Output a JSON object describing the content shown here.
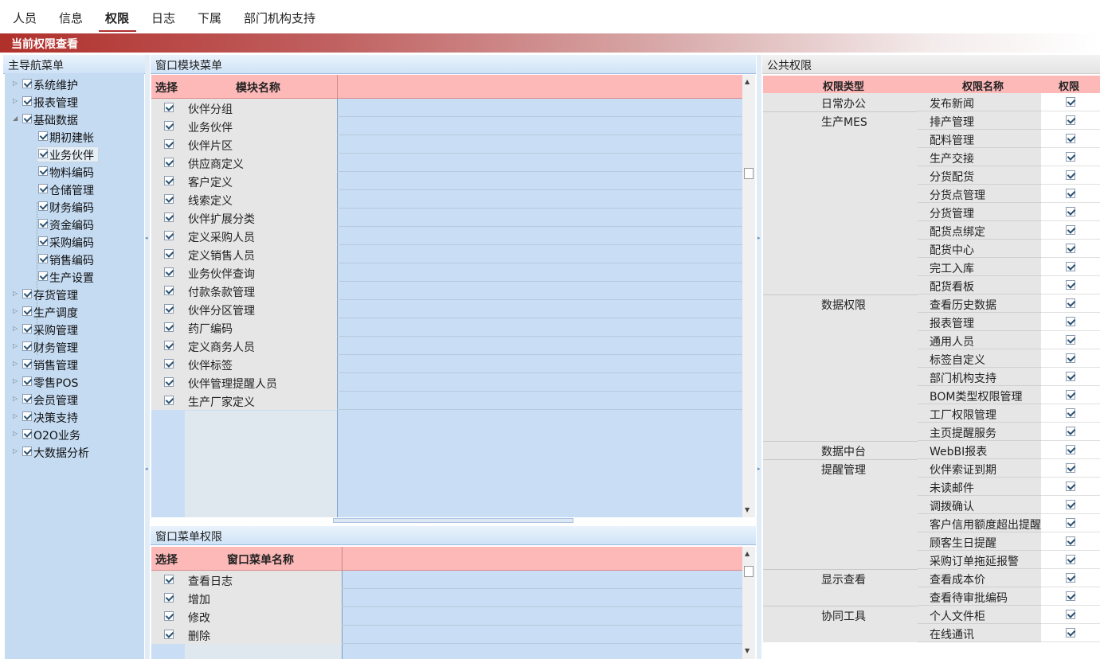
{
  "tabs": [
    {
      "label": "人员"
    },
    {
      "label": "信息"
    },
    {
      "label": "权限"
    },
    {
      "label": "日志"
    },
    {
      "label": "下属"
    },
    {
      "label": "部门机构支持"
    }
  ],
  "title": "当前权限查看",
  "nav": {
    "header": "主导航菜单",
    "items": [
      {
        "label": "系统维护",
        "level": 0,
        "expanded": false
      },
      {
        "label": "报表管理",
        "level": 0,
        "expanded": false
      },
      {
        "label": "基础数据",
        "level": 0,
        "expanded": true
      },
      {
        "label": "期初建帐",
        "level": 1
      },
      {
        "label": "业务伙伴",
        "level": 1,
        "selected": true
      },
      {
        "label": "物料编码",
        "level": 1
      },
      {
        "label": "仓储管理",
        "level": 1
      },
      {
        "label": "财务编码",
        "level": 1
      },
      {
        "label": "资金编码",
        "level": 1
      },
      {
        "label": "采购编码",
        "level": 1
      },
      {
        "label": "销售编码",
        "level": 1
      },
      {
        "label": "生产设置",
        "level": 1
      },
      {
        "label": "存货管理",
        "level": 0,
        "expanded": false
      },
      {
        "label": "生产调度",
        "level": 0,
        "expanded": false
      },
      {
        "label": "采购管理",
        "level": 0,
        "expanded": false
      },
      {
        "label": "财务管理",
        "level": 0,
        "expanded": false
      },
      {
        "label": "销售管理",
        "level": 0,
        "expanded": false
      },
      {
        "label": "零售POS",
        "level": 0,
        "expanded": false
      },
      {
        "label": "会员管理",
        "level": 0,
        "expanded": false
      },
      {
        "label": "决策支持",
        "level": 0,
        "expanded": false
      },
      {
        "label": "O2O业务",
        "level": 0,
        "expanded": false
      },
      {
        "label": "大数据分析",
        "level": 0,
        "expanded": false
      }
    ]
  },
  "module_menu": {
    "header": "窗口模块菜单",
    "col_select": "选择",
    "col_name": "模块名称",
    "rows": [
      "伙伴分组",
      "业务伙伴",
      "伙伴片区",
      "供应商定义",
      "客户定义",
      "线索定义",
      "伙伴扩展分类",
      "定义采购人员",
      "定义销售人员",
      "业务伙伴查询",
      "付款条款管理",
      "伙伴分区管理",
      "药厂编码",
      "定义商务人员",
      "伙伴标签",
      "伙伴管理提醒人员",
      "生产厂家定义"
    ]
  },
  "window_menu": {
    "header": "窗口菜单权限",
    "col_select": "选择",
    "col_name": "窗口菜单名称",
    "rows": [
      "查看日志",
      "增加",
      "修改",
      "删除"
    ]
  },
  "public": {
    "header": "公共权限",
    "col_type": "权限类型",
    "col_name": "权限名称",
    "col_perm": "权限",
    "rows": [
      {
        "type": "日常办公",
        "name": "发布新闻"
      },
      {
        "type": "生产MES",
        "name": "排产管理"
      },
      {
        "type": "",
        "name": "配料管理"
      },
      {
        "type": "",
        "name": "生产交接"
      },
      {
        "type": "",
        "name": "分货配货"
      },
      {
        "type": "",
        "name": "分货点管理"
      },
      {
        "type": "",
        "name": "分货管理"
      },
      {
        "type": "",
        "name": "配货点绑定"
      },
      {
        "type": "",
        "name": "配货中心"
      },
      {
        "type": "",
        "name": "完工入库"
      },
      {
        "type": "",
        "name": "配货看板"
      },
      {
        "type": "数据权限",
        "name": "查看历史数据"
      },
      {
        "type": "",
        "name": "报表管理"
      },
      {
        "type": "",
        "name": "通用人员"
      },
      {
        "type": "",
        "name": "标签自定义"
      },
      {
        "type": "",
        "name": "部门机构支持"
      },
      {
        "type": "",
        "name": "BOM类型权限管理"
      },
      {
        "type": "",
        "name": "工厂权限管理"
      },
      {
        "type": "",
        "name": "主页提醒服务"
      },
      {
        "type": "数据中台",
        "name": "WebBI报表"
      },
      {
        "type": "提醒管理",
        "name": "伙伴索证到期"
      },
      {
        "type": "",
        "name": "未读邮件"
      },
      {
        "type": "",
        "name": "调拨确认"
      },
      {
        "type": "",
        "name": "客户信用额度超出提醒"
      },
      {
        "type": "",
        "name": "顾客生日提醒"
      },
      {
        "type": "",
        "name": "采购订单拖延报警"
      },
      {
        "type": "显示查看",
        "name": "查看成本价"
      },
      {
        "type": "",
        "name": "查看待审批编码"
      },
      {
        "type": "协同工具",
        "name": "个人文件柜"
      },
      {
        "type": "",
        "name": "在线通讯"
      }
    ]
  }
}
